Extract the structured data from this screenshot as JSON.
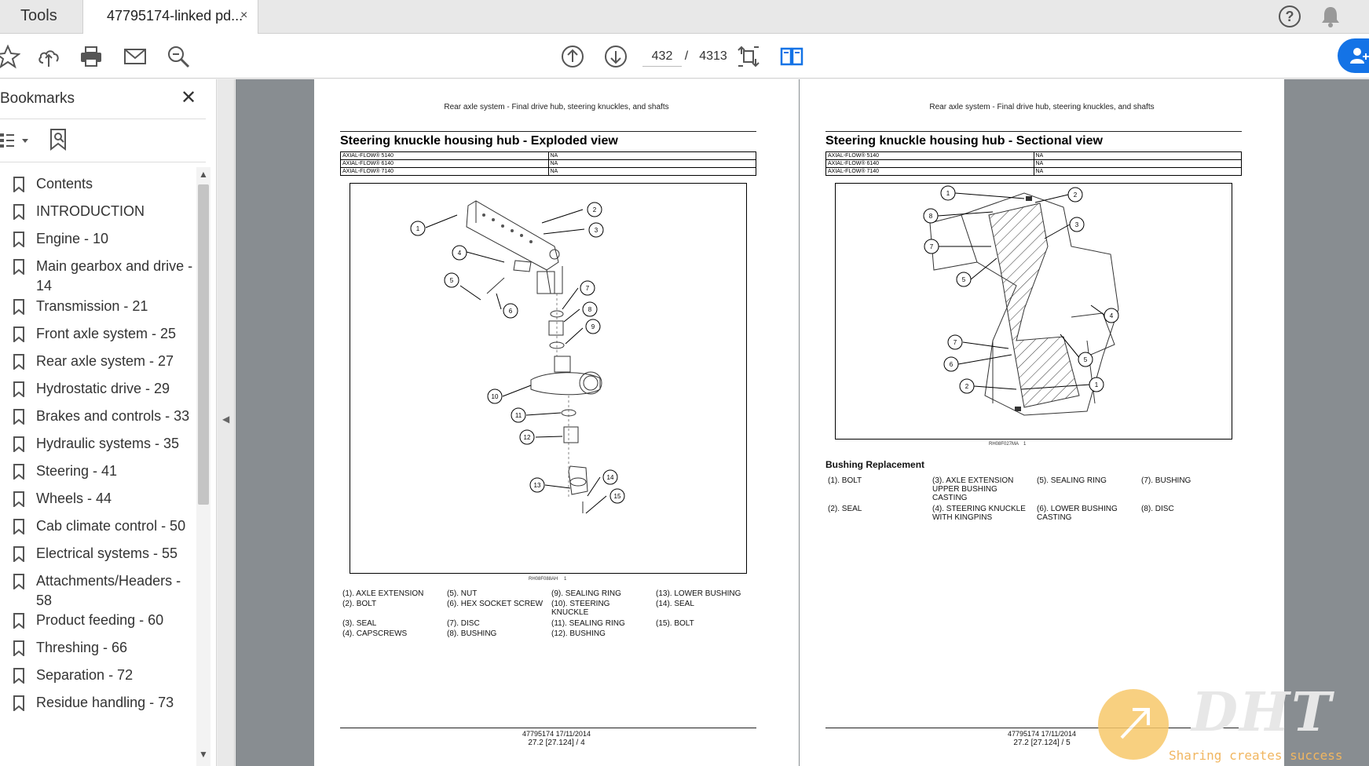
{
  "tabs": {
    "tools": "Tools",
    "document": "47795174-linked pd...",
    "close": "×"
  },
  "help_glyph": "?",
  "toolbar": {
    "current_page": "432",
    "separator": "/",
    "total_pages": "4313"
  },
  "sidebar": {
    "title": "Bookmarks",
    "close": "✕",
    "bookmarks": [
      "Contents",
      "INTRODUCTION",
      "Engine - 10",
      "Main gearbox and drive - 14",
      "Transmission - 21",
      "Front axle system - 25",
      "Rear axle system - 27",
      "Hydrostatic drive - 29",
      "Brakes and controls - 33",
      "Hydraulic systems - 35",
      "Steering - 41",
      "Wheels - 44",
      "Cab climate control - 50",
      "Electrical systems - 55",
      "Attachments/Headers - 58",
      "Product feeding - 60",
      "Threshing - 66",
      "Separation - 72",
      "Residue handling - 73"
    ]
  },
  "left_page": {
    "header": "Rear axle system - Final drive hub, steering knuckles, and shafts",
    "title": "Steering knuckle housing hub - Exploded view",
    "variants": [
      [
        "AXIAL-FLOW® 5140",
        "NA"
      ],
      [
        "AXIAL-FLOW® 6140",
        "NA"
      ],
      [
        "AXIAL-FLOW® 7140",
        "NA"
      ]
    ],
    "figure_code": "RH08F088AH",
    "figure_num": "1",
    "callouts": [
      "1",
      "2",
      "3",
      "4",
      "5",
      "6",
      "7",
      "8",
      "9",
      "10",
      "11",
      "12",
      "13",
      "14",
      "15"
    ],
    "legend": [
      "(1). AXLE EXTENSION",
      "(2). BOLT",
      "(3). SEAL",
      "(4). CAPSCREWS",
      "(5). NUT",
      "(6). HEX SOCKET SCREW",
      "(7). DISC",
      "(8). BUSHING",
      "(9). SEALING RING",
      "(10). STEERING KNUCKLE",
      "(11). SEALING RING",
      "(12). BUSHING",
      "(13). LOWER BUSHING",
      "(14). SEAL",
      "(15). BOLT"
    ],
    "footer_doc": "47795174 17/11/2014",
    "footer_page": "27.2 [27.124] / 4"
  },
  "right_page": {
    "header": "Rear axle system - Final drive hub, steering knuckles, and shafts",
    "title": "Steering knuckle housing hub - Sectional view",
    "variants": [
      [
        "AXIAL-FLOW® 5140",
        "NA"
      ],
      [
        "AXIAL-FLOW® 6140",
        "NA"
      ],
      [
        "AXIAL-FLOW® 7140",
        "NA"
      ]
    ],
    "figure_code": "RH08F027MA",
    "figure_num": "1",
    "callouts": [
      "1",
      "2",
      "8",
      "3",
      "7",
      "5",
      "4",
      "7",
      "5",
      "6",
      "2",
      "1"
    ],
    "section_heading": "Bushing Replacement",
    "legend": [
      "(1). BOLT",
      "(2). SEAL",
      "(3). AXLE EXTENSION UPPER BUSHING CASTING",
      "(4). STEERING KNUCKLE WITH KINGPINS",
      "(5). SEALING RING",
      "(6). LOWER BUSHING CASTING",
      "(7). BUSHING",
      "(8). DISC"
    ],
    "footer_doc": "47795174 17/11/2014",
    "footer_page": "27.2 [27.124] / 5"
  },
  "watermark": {
    "logo": "DHT",
    "slogan": "Sharing creates success"
  },
  "colors": {
    "accent": "#1473e6",
    "doc_bg": "#888d91",
    "watermark_orange": "#f7c86b"
  }
}
